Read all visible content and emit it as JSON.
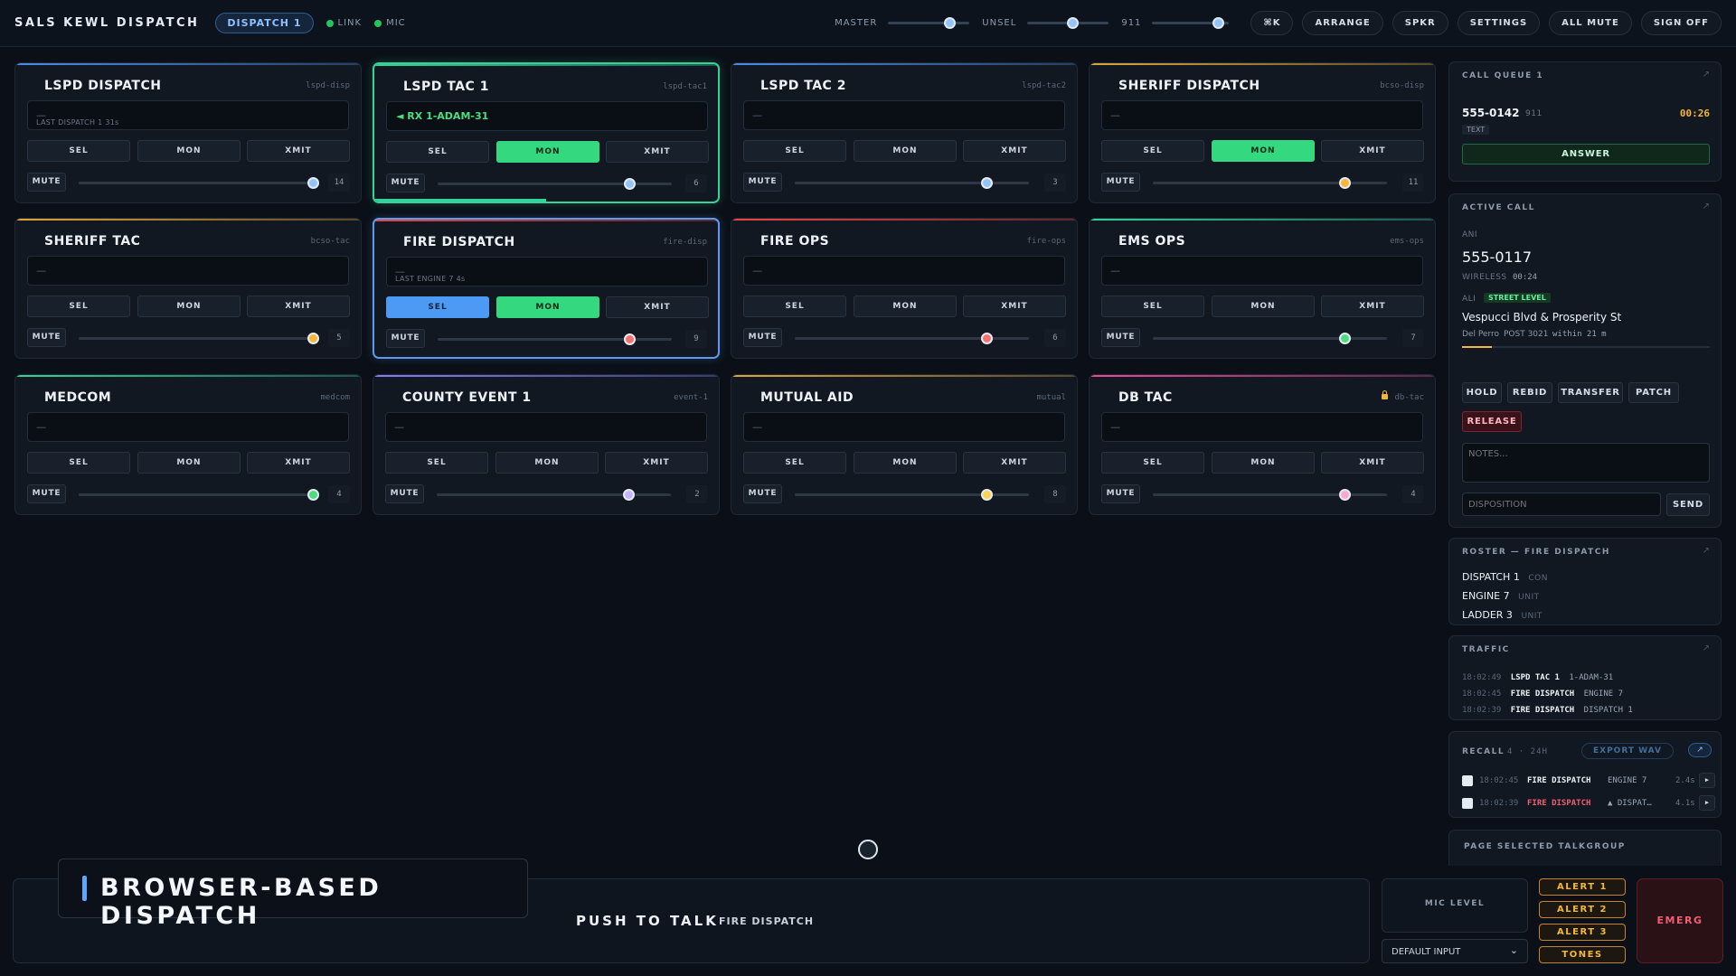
{
  "app": {
    "title": "SALS KEWL DISPATCH",
    "position": "DISPATCH 1",
    "indicators": [
      {
        "label": "LINK",
        "color": "#22c55e"
      },
      {
        "label": "MIC",
        "color": "#22c55e"
      }
    ]
  },
  "topbar": {
    "sliders": [
      {
        "label": "MASTER",
        "level": 0.75
      },
      {
        "label": "UNSEL",
        "level": 0.55
      },
      {
        "label": "911",
        "level": 0.85
      }
    ],
    "buttons": [
      "⌘K",
      "ARRANGE",
      "SPKR",
      "SETTINGS",
      "ALL MUTE",
      "SIGN OFF"
    ]
  },
  "channels": [
    {
      "name": "LSPD DISPATCH",
      "id": "lspd-disp",
      "accent": "#4b8de8",
      "display": "—",
      "last": "LAST DISPATCH 1 31s",
      "rx": "",
      "sel": false,
      "mon": false,
      "volume": 14,
      "level": 1.0,
      "knob": "#93c5fd",
      "locked": false
    },
    {
      "name": "LSPD TAC 1",
      "id": "lspd-tac1",
      "accent": "#34d399",
      "display": "",
      "last": "",
      "rx": "◄ RX 1-ADAM-31",
      "sel": false,
      "mon": true,
      "volume": 6,
      "level": 0.82,
      "knob": "#93c5fd",
      "locked": false
    },
    {
      "name": "LSPD TAC 2",
      "id": "lspd-tac2",
      "accent": "#4b8de8",
      "display": "—",
      "last": "",
      "rx": "",
      "sel": false,
      "mon": false,
      "volume": 3,
      "level": 0.82,
      "knob": "#93c5fd",
      "locked": false
    },
    {
      "name": "SHERIFF DISPATCH",
      "id": "bcso-disp",
      "accent": "#e0a53a",
      "display": "—",
      "last": "",
      "rx": "",
      "sel": false,
      "mon": true,
      "volume": 11,
      "level": 0.82,
      "knob": "#f5b73b",
      "locked": false
    },
    {
      "name": "SHERIFF TAC",
      "id": "bcso-tac",
      "accent": "#e0a53a",
      "display": "—",
      "last": "",
      "rx": "",
      "sel": false,
      "mon": false,
      "volume": 5,
      "level": 1.0,
      "knob": "#f5b73b",
      "locked": false
    },
    {
      "name": "FIRE DISPATCH",
      "id": "fire-disp",
      "accent": "#ef4444",
      "display": "—",
      "last": "LAST ENGINE 7 4s",
      "rx": "",
      "sel": true,
      "mon": true,
      "volume": 9,
      "level": 0.82,
      "knob": "#f87171",
      "locked": false
    },
    {
      "name": "FIRE OPS",
      "id": "fire-ops",
      "accent": "#ef4444",
      "display": "—",
      "last": "",
      "rx": "",
      "sel": false,
      "mon": false,
      "volume": 6,
      "level": 0.82,
      "knob": "#f87171",
      "locked": false
    },
    {
      "name": "EMS OPS",
      "id": "ems-ops",
      "accent": "#34d399",
      "display": "—",
      "last": "",
      "rx": "",
      "sel": false,
      "mon": false,
      "volume": 7,
      "level": 0.82,
      "knob": "#4ade80",
      "locked": false
    },
    {
      "name": "MEDCOM",
      "id": "medcom",
      "accent": "#34d399",
      "display": "—",
      "last": "",
      "rx": "",
      "sel": false,
      "mon": false,
      "volume": 4,
      "level": 1.0,
      "knob": "#4ade80",
      "locked": false
    },
    {
      "name": "COUNTY EVENT 1",
      "id": "event-1",
      "accent": "#8b7cf6",
      "display": "—",
      "last": "",
      "rx": "",
      "sel": false,
      "mon": false,
      "volume": 2,
      "level": 0.82,
      "knob": "#c4b5fd",
      "locked": false
    },
    {
      "name": "MUTUAL AID",
      "id": "mutual",
      "accent": "#e0a53a",
      "display": "—",
      "last": "",
      "rx": "",
      "sel": false,
      "mon": false,
      "volume": 8,
      "level": 0.82,
      "knob": "#fcd34d",
      "locked": false
    },
    {
      "name": "DB TAC",
      "id": "db-tac",
      "accent": "#ec4899",
      "display": "—",
      "last": "",
      "rx": "",
      "sel": false,
      "mon": false,
      "volume": 4,
      "level": 0.82,
      "knob": "#f9a8d4",
      "locked": true
    }
  ],
  "channel_labels": {
    "sel": "SEL",
    "mon": "MON",
    "xmit": "XMIT",
    "mute": "MUTE"
  },
  "call_queue": {
    "title": "CALL QUEUE 1",
    "number": "555-0142",
    "source": "911",
    "timer": "00:26",
    "tag": "TEXT",
    "answer": "ANSWER"
  },
  "active_call": {
    "title": "ACTIVE CALL",
    "ani_label": "ANI",
    "number": "555-0117",
    "type": "WIRELESS",
    "duration": "00:24",
    "ali_label": "ALI",
    "level_badge": "STREET LEVEL",
    "address": "Vespucci Blvd & Prosperity St",
    "area": "Del Perro",
    "postal": "POST 3021",
    "accuracy": "within 21 m",
    "accuracy_level": 0.12,
    "buttons": [
      "HOLD",
      "REBID",
      "TRANSFER",
      "PATCH"
    ],
    "release": "RELEASE",
    "notes_placeholder": "NOTES...",
    "disposition_placeholder": "DISPOSITION",
    "send": "SEND"
  },
  "roster": {
    "title": "ROSTER — FIRE DISPATCH",
    "items": [
      {
        "name": "DISPATCH 1",
        "type": "CON"
      },
      {
        "name": "ENGINE 7",
        "type": "UNIT"
      },
      {
        "name": "LADDER 3",
        "type": "UNIT"
      }
    ]
  },
  "traffic": {
    "title": "TRAFFIC",
    "items": [
      {
        "time": "18:02:49",
        "channel": "LSPD TAC 1",
        "unit": "1-ADAM-31"
      },
      {
        "time": "18:02:45",
        "channel": "FIRE DISPATCH",
        "unit": "ENGINE 7"
      },
      {
        "time": "18:02:39",
        "channel": "FIRE DISPATCH",
        "unit": "DISPATCH 1"
      }
    ]
  },
  "recall": {
    "title": "RECALL",
    "count": "4 · 24H",
    "export": "EXPORT WAV",
    "items": [
      {
        "time": "18:02:45",
        "channel": "FIRE DISPATCH",
        "unit": "ENGINE 7",
        "length": "2.4s",
        "emergency": false
      },
      {
        "time": "18:02:39",
        "channel": "FIRE DISPATCH",
        "unit": "▲ DISPAT…",
        "length": "4.1s",
        "emergency": true
      }
    ]
  },
  "page_section": {
    "title": "PAGE SELECTED TALKGROUP"
  },
  "bottom": {
    "banner": "BROWSER-BASED DISPATCH",
    "ptt_label": "PUSH TO TALK",
    "ptt_channel": "FIRE DISPATCH",
    "mic_level": "MIC LEVEL",
    "input_device": "DEFAULT INPUT",
    "alerts": [
      "ALERT 1",
      "ALERT 2",
      "ALERT 3",
      "TONES"
    ],
    "emerg": "EMERG"
  },
  "colors": {
    "accent": "#4d9af5",
    "active": "#34d97f",
    "emergency": "#f05e72",
    "alert": "#f5b73b"
  }
}
